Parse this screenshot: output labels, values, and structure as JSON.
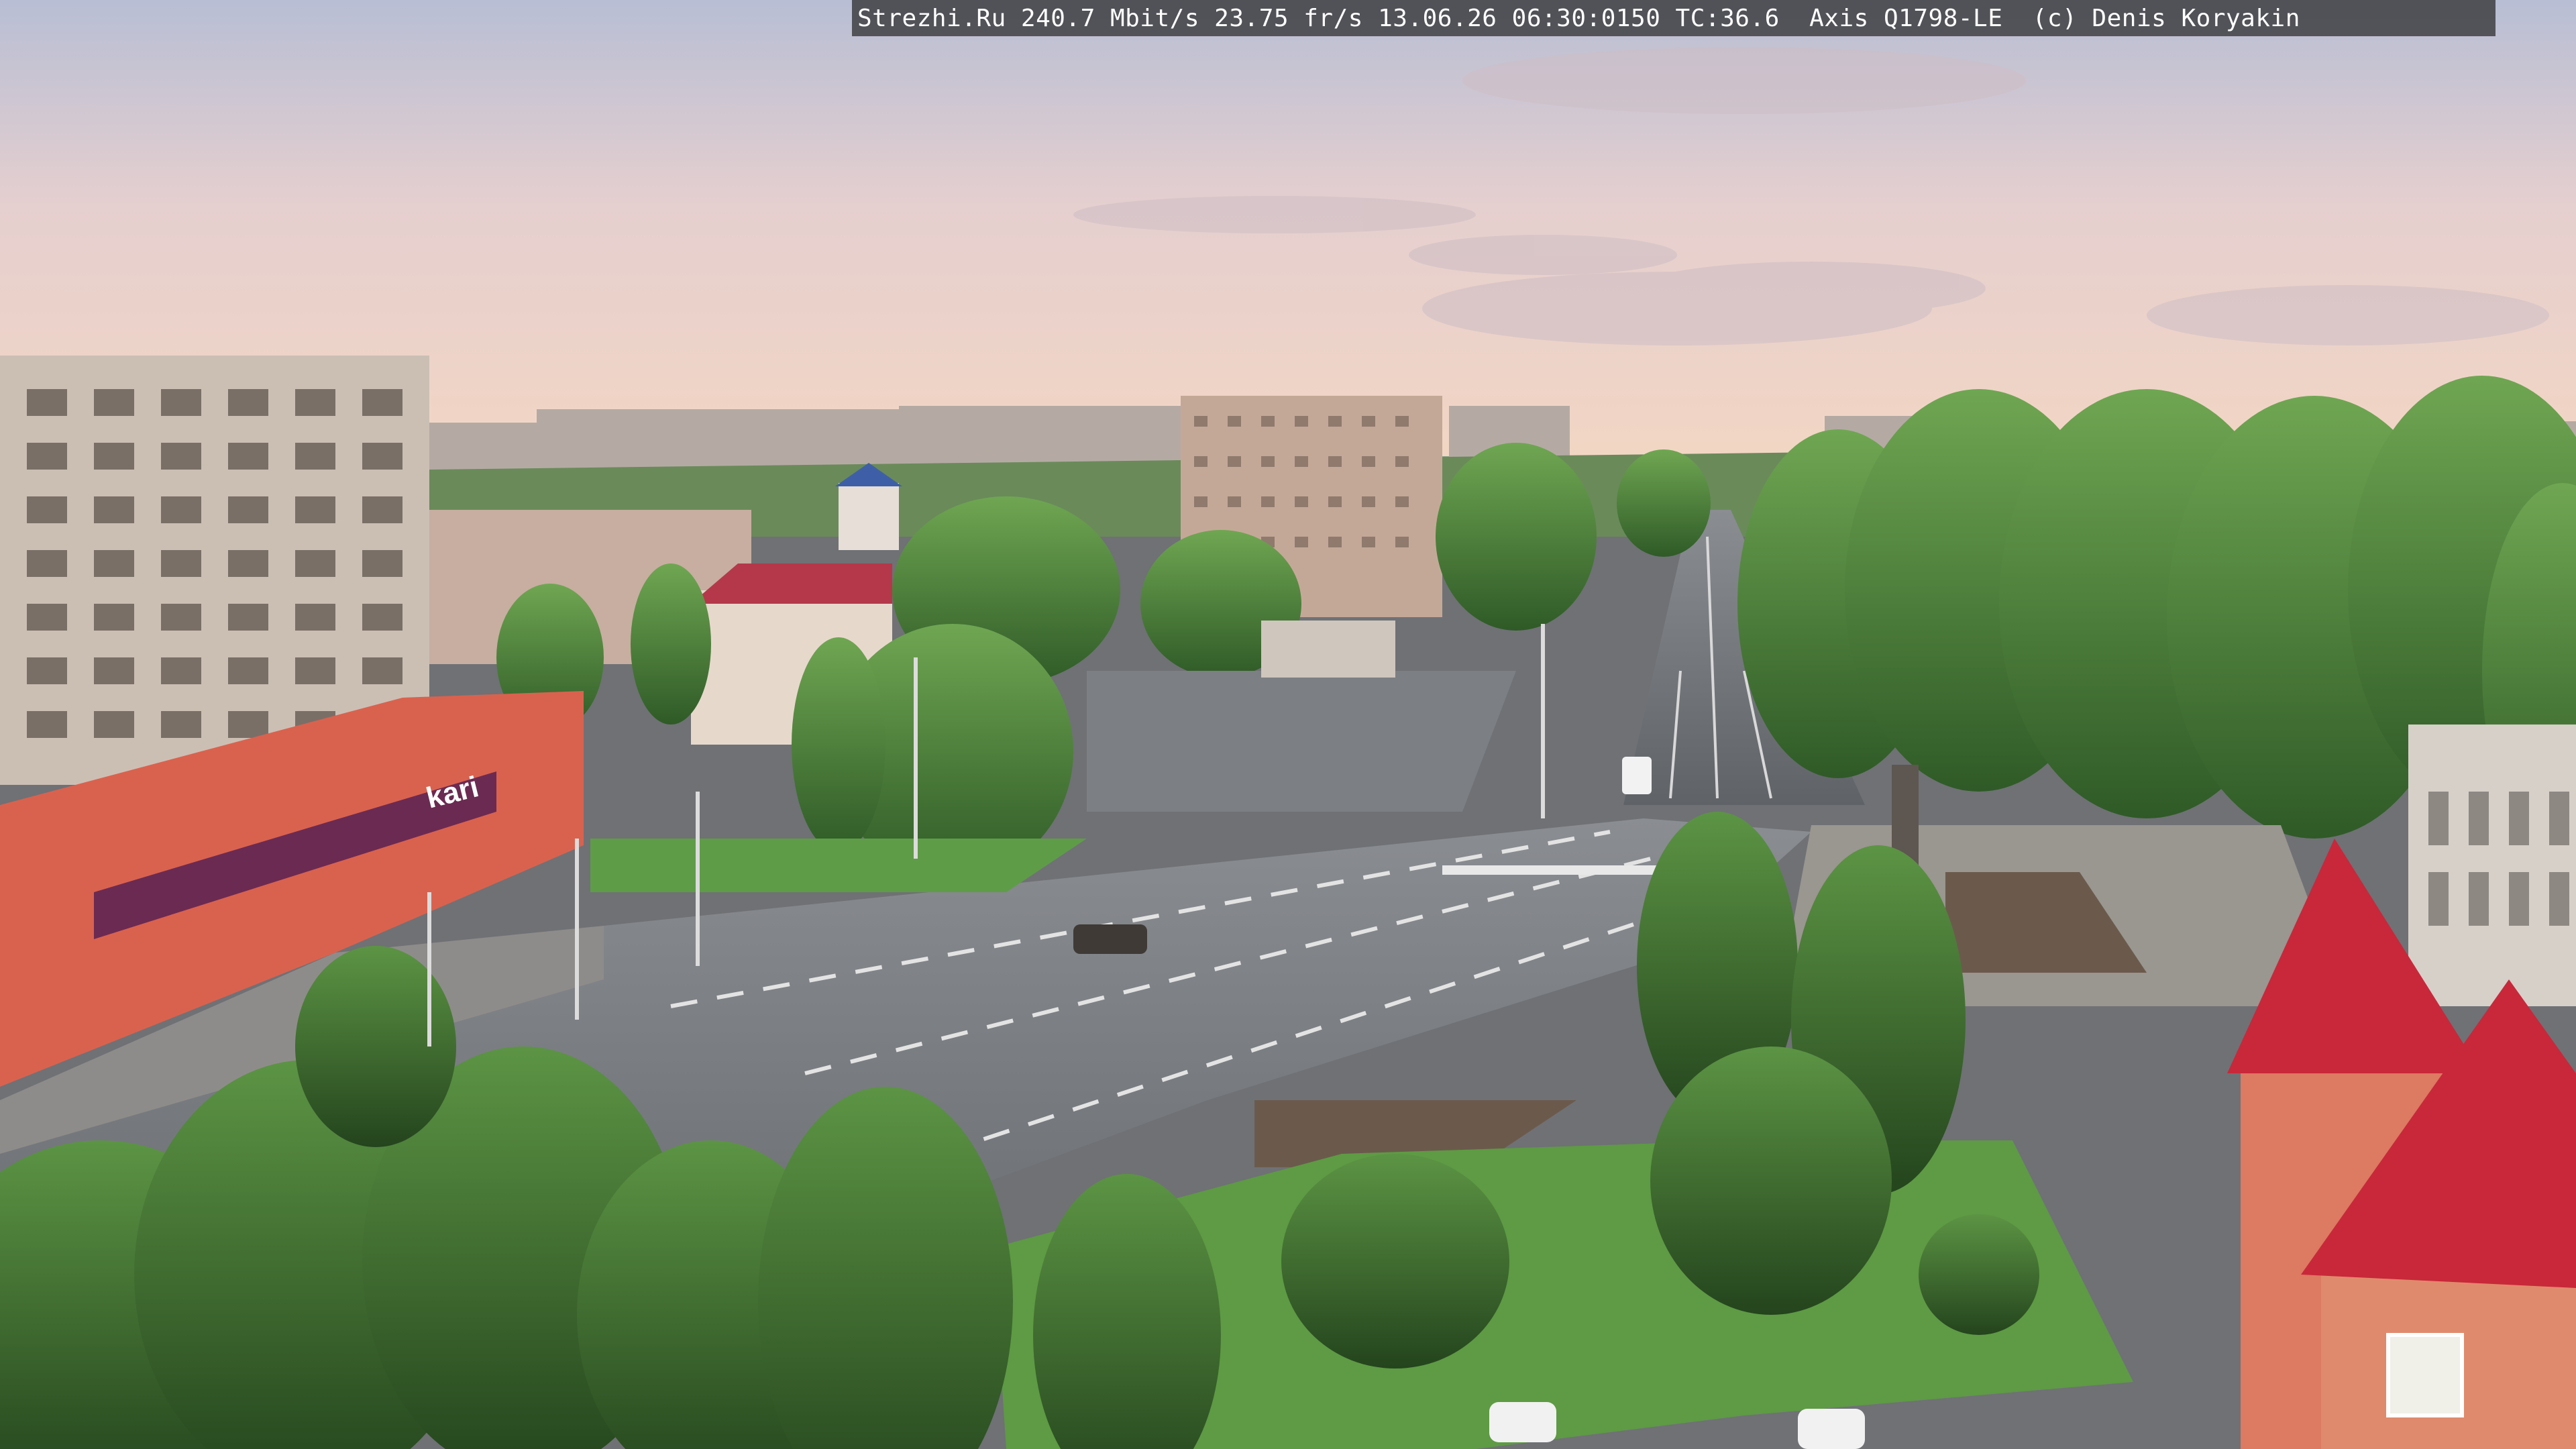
{
  "overlay": {
    "caption": "Strezhi.Ru 240.7 Mbit/s 23.75 fr/s 13.06.26 06:30:0150 TC:36.6  Axis Q1798-LE  (c) Denis Koryakin"
  },
  "signage": {
    "store_logo": "kari"
  },
  "scene": {
    "description_colors": {
      "sky_top": "#b9bfd2",
      "sky_horizon": "#f1d2c2",
      "trees": "#4f8a3c",
      "grass": "#5f9c48",
      "asphalt": "#6b6e72",
      "building_beige": "#c9b8a3",
      "building_red": "#d7604a",
      "roof_red": "#c8283a"
    }
  }
}
